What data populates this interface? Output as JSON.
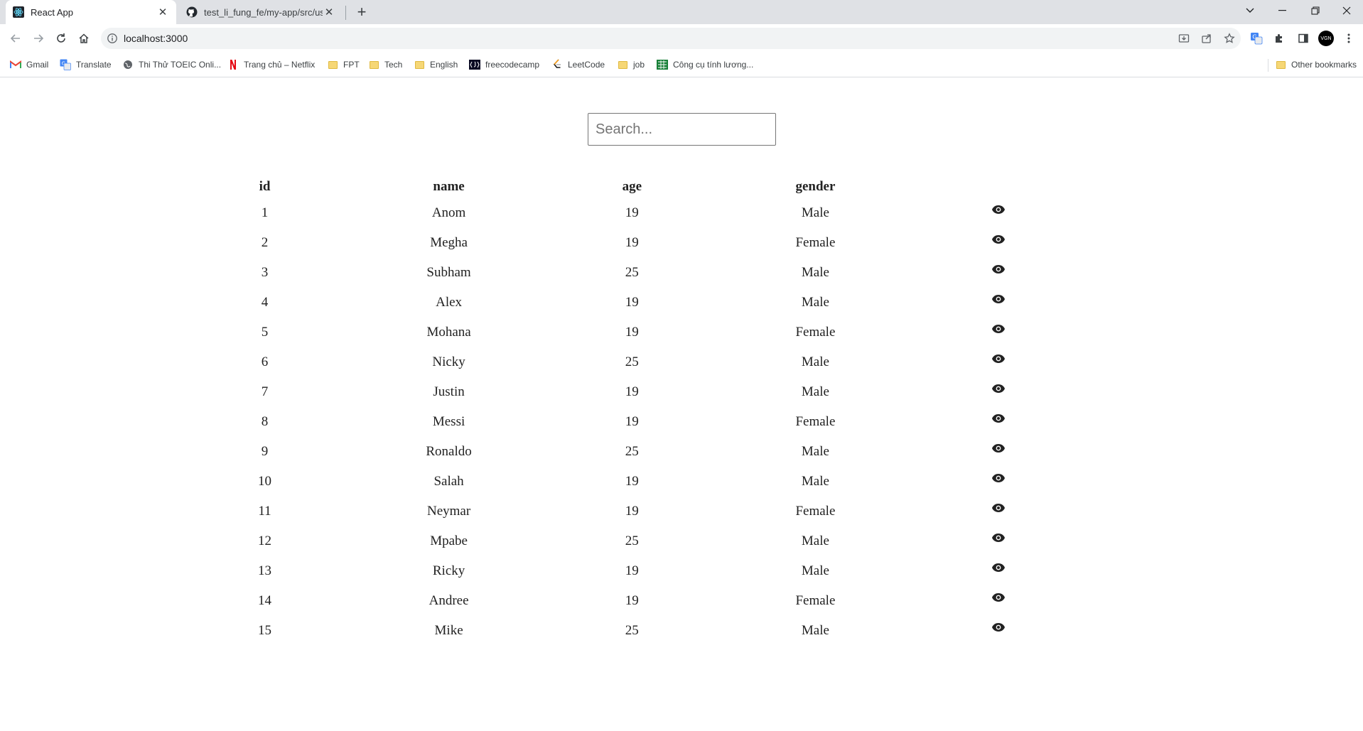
{
  "browser": {
    "tabs": [
      {
        "title": "React App",
        "active": true
      },
      {
        "title": "test_li_fung_fe/my-app/src/user.js",
        "active": false
      }
    ],
    "address": "localhost:3000",
    "profile_initials": "VGN",
    "bookmarks": [
      {
        "label": "Gmail",
        "icon": "gmail-icon"
      },
      {
        "label": "Translate",
        "icon": "translate-icon"
      },
      {
        "label": "Thi Thử TOEIC Onli...",
        "icon": "globe-icon"
      },
      {
        "label": "Trang chủ – Netflix",
        "icon": "netflix-icon"
      },
      {
        "label": "FPT",
        "icon": "folder-icon"
      },
      {
        "label": "Tech",
        "icon": "folder-icon"
      },
      {
        "label": "English",
        "icon": "folder-icon"
      },
      {
        "label": "freecodecamp",
        "icon": "freecodecamp-icon"
      },
      {
        "label": "LeetCode",
        "icon": "leetcode-icon"
      },
      {
        "label": "job",
        "icon": "folder-icon"
      },
      {
        "label": "Công cụ tính lương...",
        "icon": "sheet-icon"
      }
    ],
    "other_bookmarks": "Other bookmarks"
  },
  "page": {
    "search_placeholder": "Search...",
    "columns": [
      "id",
      "name",
      "age",
      "gender"
    ],
    "rows": [
      {
        "id": "1",
        "name": "Anom",
        "age": "19",
        "gender": "Male"
      },
      {
        "id": "2",
        "name": "Megha",
        "age": "19",
        "gender": "Female"
      },
      {
        "id": "3",
        "name": "Subham",
        "age": "25",
        "gender": "Male"
      },
      {
        "id": "4",
        "name": "Alex",
        "age": "19",
        "gender": "Male"
      },
      {
        "id": "5",
        "name": "Mohana",
        "age": "19",
        "gender": "Female"
      },
      {
        "id": "6",
        "name": "Nicky",
        "age": "25",
        "gender": "Male"
      },
      {
        "id": "7",
        "name": "Justin",
        "age": "19",
        "gender": "Male"
      },
      {
        "id": "8",
        "name": "Messi",
        "age": "19",
        "gender": "Female"
      },
      {
        "id": "9",
        "name": "Ronaldo",
        "age": "25",
        "gender": "Male"
      },
      {
        "id": "10",
        "name": "Salah",
        "age": "19",
        "gender": "Male"
      },
      {
        "id": "11",
        "name": "Neymar",
        "age": "19",
        "gender": "Female"
      },
      {
        "id": "12",
        "name": "Mpabe",
        "age": "25",
        "gender": "Male"
      },
      {
        "id": "13",
        "name": "Ricky",
        "age": "19",
        "gender": "Male"
      },
      {
        "id": "14",
        "name": "Andree",
        "age": "19",
        "gender": "Female"
      },
      {
        "id": "15",
        "name": "Mike",
        "age": "25",
        "gender": "Male"
      }
    ],
    "row_action_icon": "eye-icon"
  }
}
